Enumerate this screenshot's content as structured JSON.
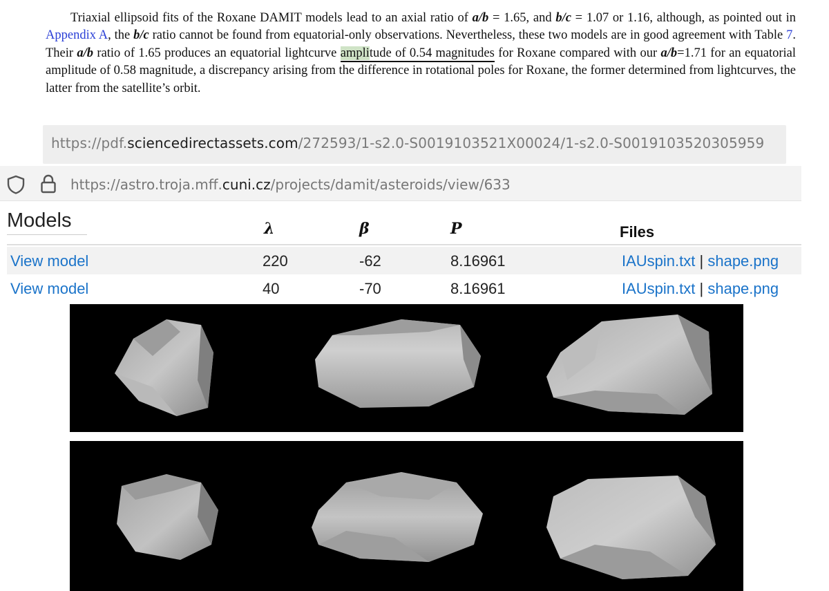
{
  "paper": {
    "s1_a": "Triaxial ellipsoid fits of the Roxane DAMIT models lead to an axial ratio of ",
    "s1_ab": "a/b",
    "s1_b": " = 1.65, and ",
    "s1_bc": "b/c",
    "s1_c": " = 1.07 or 1.16, although, as pointed out in ",
    "s1_link": "Appendix A",
    "s1_d": ", the ",
    "s1_bc2": "b/c",
    "s1_e": " ratio cannot be found from equatorial-only observations. Nevertheless, these two models are in good agreement with Table ",
    "s1_table_link": "7",
    "s1_f": ".  Their ",
    "s1_ab2": "a/b",
    "s1_g": " ratio of 1.65 produces an equatorial lightcurve ",
    "s1_hl": "ampli",
    "s1_ul": "tude of 0.54 magnitudes",
    "s1_h": " for Roxane compared with our ",
    "s1_ab3": "a/b",
    "s1_i": "=1.71 for an equatorial amplitude of 0.58 magnitude, a discrepancy arising from the difference in rotational poles for Roxane, the former determined from lightcurves, the latter from the satellite’s orbit."
  },
  "url1": {
    "prefix": "https://pdf.",
    "domain": "sciencedirectassets.com",
    "path": "/272593/1-s2.0-S0019103521X00024/1-s2.0-S0019103520305959"
  },
  "url2": {
    "prefix": "https://astro.troja.mff.",
    "domain": "cuni.cz",
    "path": "/projects/damit/asteroids/view/633",
    "icons": [
      "shield-icon",
      "lock-icon"
    ]
  },
  "models": {
    "title": "Models",
    "headers": {
      "lambda": "λ",
      "beta": "β",
      "period": "P",
      "files": "Files"
    },
    "rows": [
      {
        "link": "View model",
        "lambda": "220",
        "beta": "-62",
        "period": "8.16961",
        "file1": "IAUspin.txt",
        "sep": "|",
        "file2": "shape.png"
      },
      {
        "link": "View model",
        "lambda": "40",
        "beta": "-70",
        "period": "8.16961",
        "file1": "IAUspin.txt",
        "sep": "|",
        "file2": "shape.png"
      }
    ]
  },
  "colors": {
    "link": "#1a73c9",
    "paper_link": "#2a3fd6",
    "highlight": "#cfe3c6",
    "render_bg": "#000000"
  }
}
